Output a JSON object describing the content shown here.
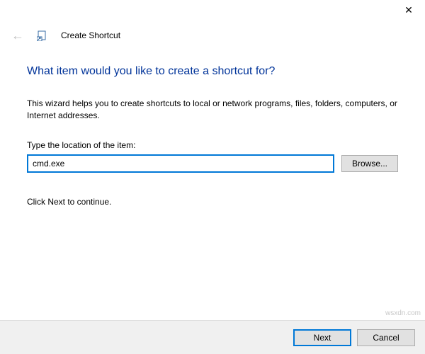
{
  "titlebar": {
    "close_label": "✕"
  },
  "header": {
    "back_icon": "←",
    "title": "Create Shortcut"
  },
  "main": {
    "heading": "What item would you like to create a shortcut for?",
    "description": "This wizard helps you to create shortcuts to local or network programs, files, folders, computers, or Internet addresses.",
    "field_label": "Type the location of the item:",
    "location_value": "cmd.exe",
    "browse_label": "Browse...",
    "continue_text": "Click Next to continue."
  },
  "footer": {
    "next_label": "Next",
    "cancel_label": "Cancel"
  },
  "watermark": "wsxdn.com"
}
